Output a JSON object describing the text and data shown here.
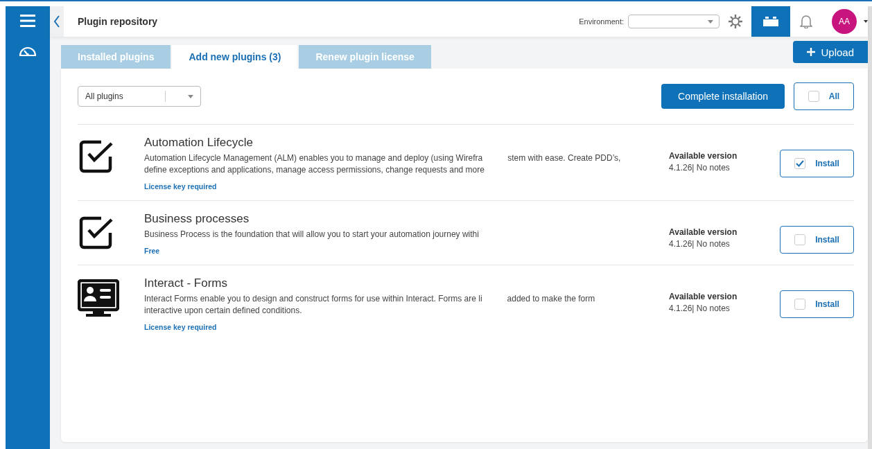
{
  "header": {
    "title": "Plugin repository",
    "environment_label": "Environment:",
    "avatar": "AA"
  },
  "tabs": [
    {
      "label": "Installed plugins",
      "selected": false
    },
    {
      "label": "Add new plugins (3)",
      "selected": true
    },
    {
      "label": "Renew plugin license",
      "selected": false
    }
  ],
  "upload_button": "Upload",
  "filter": {
    "value": "All plugins"
  },
  "complete_button": "Complete installation",
  "select_all": {
    "label": "All",
    "checked": false
  },
  "plugins": [
    {
      "kind": "checkbox",
      "name": "Automation Lifecycle",
      "description_lines": [
        [
          "Automation Lifecycle Management (ALM) enables you to manage and deploy (using Wirefra",
          "stem with ease. Create PDD’s,"
        ],
        [
          "define exceptions and applications, manage access permissions, change requests and more"
        ]
      ],
      "license": "License key required",
      "version_label": "Available version",
      "version": "4.1.26| No notes",
      "install": {
        "label": "Install",
        "checked": true
      }
    },
    {
      "kind": "checkbox",
      "name": "Business processes",
      "description_lines": [
        [
          "Business Process is the foundation that will allow you to start your automation journey withi"
        ]
      ],
      "license": "Free",
      "version_label": "Available version",
      "version": "4.1.26| No notes",
      "install": {
        "label": "Install",
        "checked": false
      }
    },
    {
      "kind": "monitor",
      "name": "Interact - Forms",
      "description_lines": [
        [
          "Interact Forms enable you to design and construct forms for use within Interact. Forms are li",
          "added to make the form"
        ],
        [
          "interactive upon certain defined conditions."
        ]
      ],
      "license": "License key required",
      "version_label": "Available version",
      "version": "4.1.26| No notes",
      "install": {
        "label": "Install",
        "checked": false
      }
    }
  ]
}
